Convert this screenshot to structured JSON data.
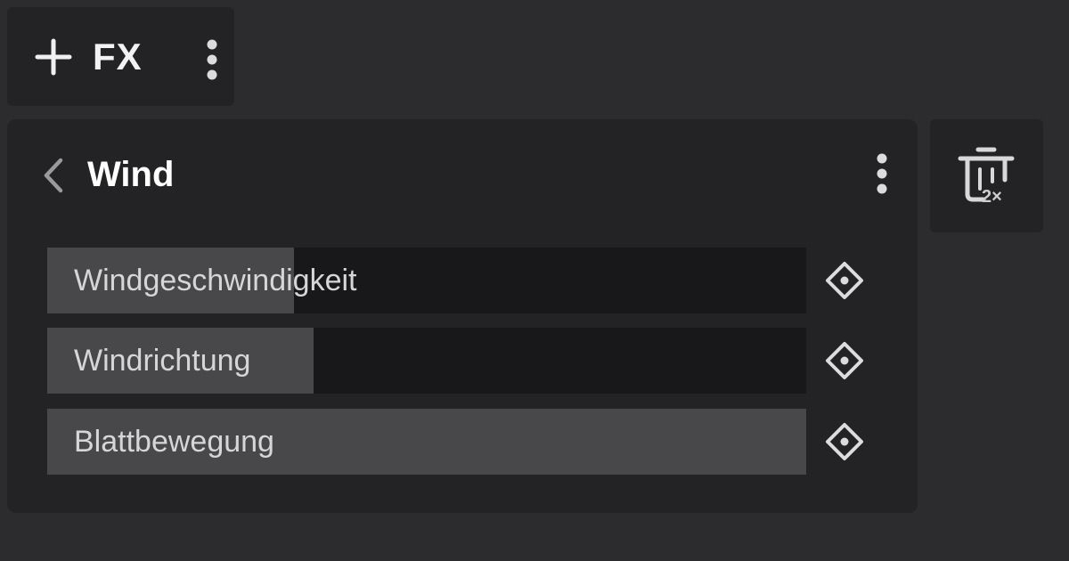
{
  "toolbar": {
    "add_icon": "plus-icon",
    "fx_label": "FX",
    "more_icon": "more-vertical-icon"
  },
  "panel": {
    "back_icon": "chevron-left-icon",
    "title": "Wind",
    "more_icon": "more-vertical-icon",
    "params": [
      {
        "label": "Windgeschwindigkeit",
        "fill_percent": 32.5,
        "keyframe_icon": "keyframe-diamond-icon"
      },
      {
        "label": "Windrichtung",
        "fill_percent": 35.1,
        "keyframe_icon": "keyframe-diamond-icon"
      },
      {
        "label": "Blattbewegung",
        "fill_percent": 100,
        "keyframe_icon": "keyframe-diamond-icon"
      }
    ]
  },
  "delete_button": {
    "icon": "trash-icon",
    "badge": "2×"
  },
  "colors": {
    "background": "#2c2c2f",
    "panel": "#232325",
    "track": "#18181a",
    "fill": "#48484b",
    "text": "#d6d6d6"
  }
}
